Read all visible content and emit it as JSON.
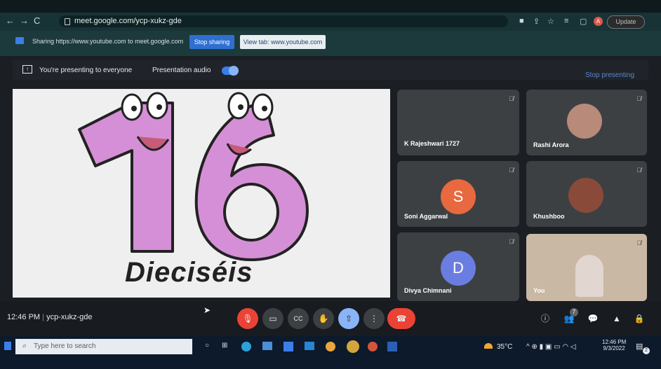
{
  "browser": {
    "url": "meet.google.com/ycp-xukz-gde",
    "update_label": "Update",
    "profile_letter": "A"
  },
  "share_bar": {
    "text": "Sharing https://www.youtube.com to meet.google.com",
    "stop_sharing": "Stop sharing",
    "view_tab": "View tab: www.youtube.com"
  },
  "presentation_bar": {
    "presenting": "You're presenting to everyone",
    "audio": "Presentation audio",
    "stop_presenting": "Stop presenting"
  },
  "slide": {
    "number": "16",
    "caption": "Dieciséis"
  },
  "participants": [
    {
      "name": "K Rajeshwari 1727"
    },
    {
      "name": "Rashi Arora"
    },
    {
      "name": "Soni Aggarwal",
      "initial": "S",
      "color": "#e8683f"
    },
    {
      "name": "Khushboo"
    },
    {
      "name": "Divya Chimnani",
      "initial": "D",
      "color": "#6a7de0"
    },
    {
      "name": "You"
    }
  ],
  "meeting": {
    "time": "12:46 PM",
    "code": "ycp-xukz-gde",
    "people_badge": "7"
  },
  "taskbar": {
    "search_placeholder": "Type here to search",
    "temperature": "35°C",
    "clock_time": "12:46 PM",
    "clock_date": "9/3/2022",
    "notification_count": "2"
  },
  "colors": {
    "end_call": "#ea4335",
    "mic_off": "#ea4335",
    "accent": "#3c7ee8",
    "digit_fill": "#d58fd6"
  }
}
